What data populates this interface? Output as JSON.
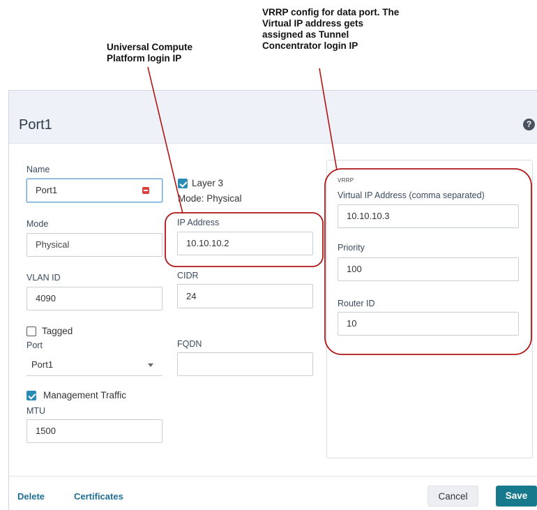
{
  "annotations": {
    "ucp_login": "Universal Compute\nPlatform login IP",
    "vrrp_note": "VRRP config for data port. The\nVirtual IP address gets\nassigned as Tunnel\nConcentrator login IP"
  },
  "dialog": {
    "title": "Port1",
    "help_icon": "question-circle-icon"
  },
  "form": {
    "name_label": "Name",
    "name_value": "Port1",
    "mode_label": "Mode",
    "mode_value": "Physical",
    "vlan_label": "VLAN ID",
    "vlan_value": "4090",
    "tagged_label": "Tagged",
    "tagged_checked": false,
    "port_label": "Port",
    "port_value": "Port1",
    "mgmt_label": "Management Traffic",
    "mgmt_checked": true,
    "mtu_label": "MTU",
    "mtu_value": "1500",
    "layer3_label": "Layer 3",
    "layer3_checked": true,
    "mode_text": "Mode: Physical",
    "ip_label": "IP Address",
    "ip_value": "10.10.10.2",
    "cidr_label": "CIDR",
    "cidr_value": "24",
    "fqdn_label": "FQDN",
    "fqdn_value": ""
  },
  "vrrp": {
    "section_label": "VRRP",
    "vip_label": "Virtual IP Address (comma separated)",
    "vip_value": "10.10.10.3",
    "priority_label": "Priority",
    "priority_value": "100",
    "router_id_label": "Router ID",
    "router_id_value": "10"
  },
  "footer": {
    "delete_label": "Delete",
    "certificates_label": "Certificates",
    "cancel_label": "Cancel",
    "save_label": "Save"
  },
  "colors": {
    "accent": "#167a8c",
    "link": "#1f6f95",
    "annotation": "#b01414",
    "header_bg": "#eef1f7",
    "checkbox": "#2a8bb5",
    "required": "#d9413b"
  }
}
